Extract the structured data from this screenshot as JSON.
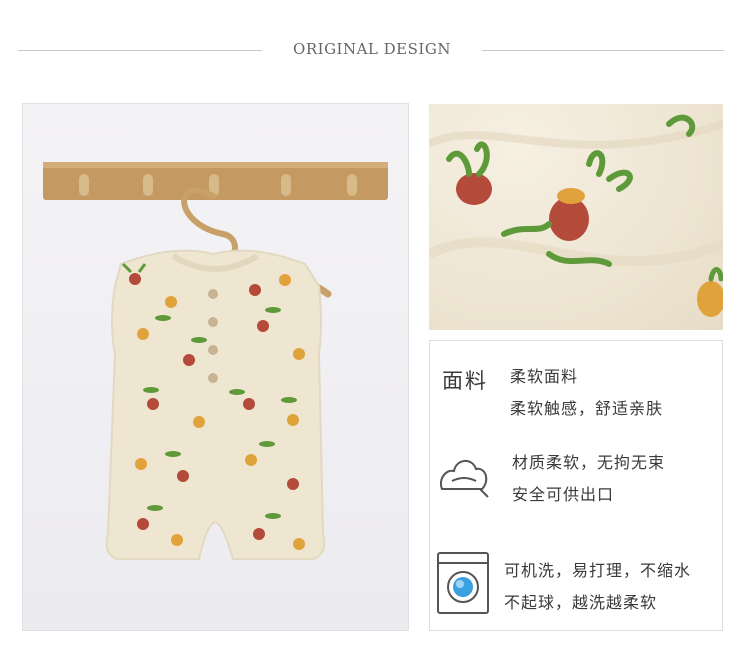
{
  "header": {
    "title": "ORIGINAL DESIGN"
  },
  "panel": {
    "section_label": "面料",
    "features": [
      {
        "icon": "fabric-label",
        "lines": [
          "柔软面料",
          "柔软触感，舒适亲肤"
        ]
      },
      {
        "icon": "cloud-soft-icon",
        "lines": [
          "材质柔软，无拘无束",
          "安全可供出口"
        ]
      },
      {
        "icon": "washing-machine-icon",
        "lines": [
          "可机洗，易打理，不缩水",
          "不起球，越洗越柔软"
        ]
      }
    ]
  },
  "colors": {
    "fabric": "#efe6d2",
    "radish_red": "#b44a3a",
    "radish_orange": "#e0a23a",
    "leaf_green": "#5e9a3a",
    "wood": "#c8a16a"
  }
}
